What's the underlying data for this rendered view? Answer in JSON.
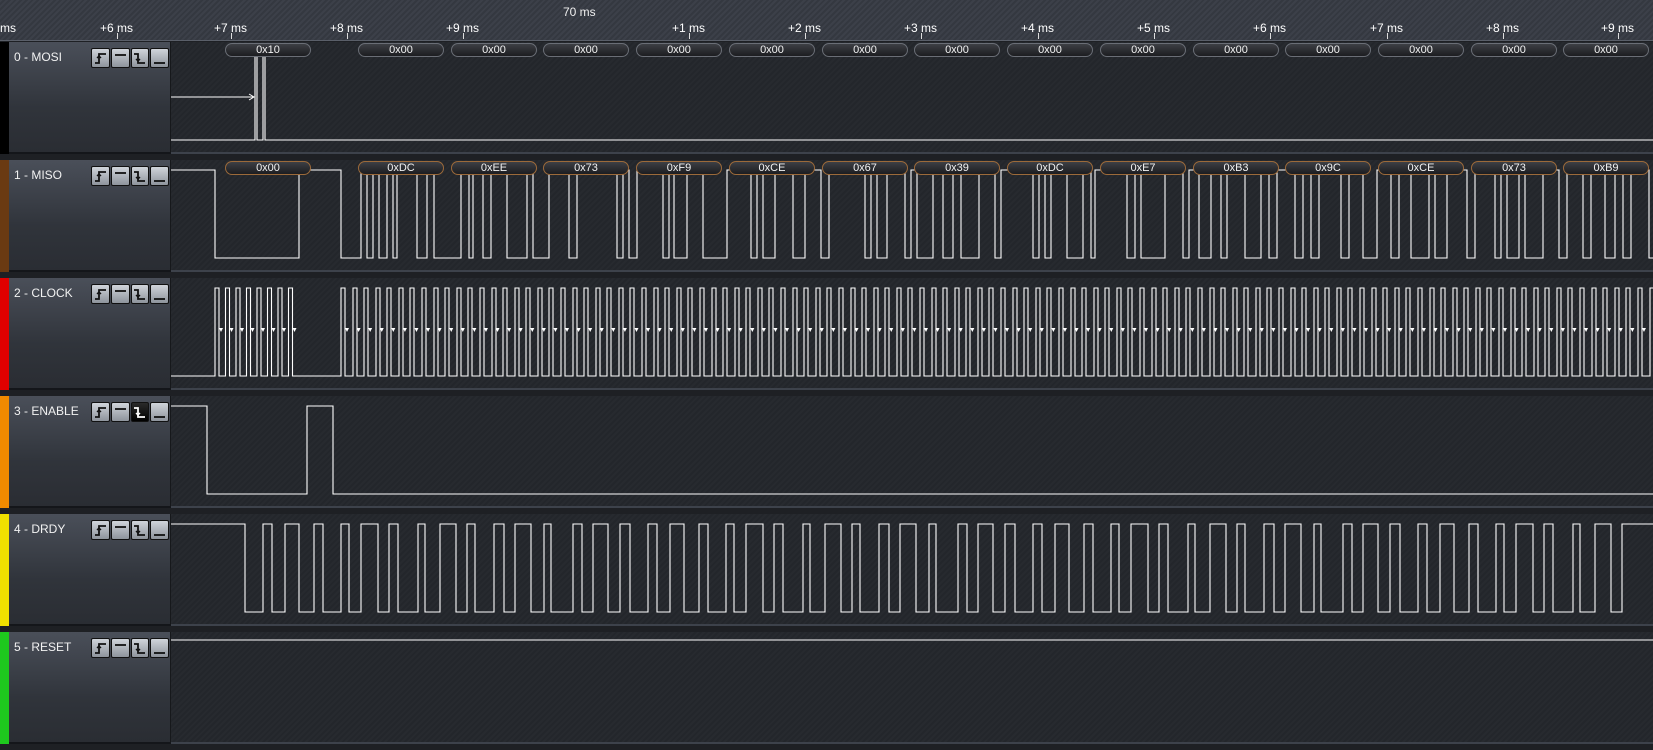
{
  "ruler": {
    "marker_label": "70 ms",
    "ticks": [
      {
        "label": "ms"
      },
      {
        "label": "+6 ms"
      },
      {
        "label": "+7 ms"
      },
      {
        "label": "+8 ms"
      },
      {
        "label": "+9 ms"
      },
      {
        "label": "+1 ms"
      },
      {
        "label": "+2 ms"
      },
      {
        "label": "+3 ms"
      },
      {
        "label": "+4 ms"
      },
      {
        "label": "+5 ms"
      },
      {
        "label": "+6 ms"
      },
      {
        "label": "+7 ms"
      },
      {
        "label": "+8 ms"
      },
      {
        "label": "+9 ms"
      }
    ]
  },
  "trigger_icons": [
    "rising-edge-icon",
    "high-level-icon",
    "falling-edge-icon",
    "low-level-icon"
  ],
  "channels": [
    {
      "name": "0 - MOSI",
      "color": "#000000",
      "active_trigger": -1
    },
    {
      "name": "1 - MISO",
      "color": "#6a3a12",
      "active_trigger": -1
    },
    {
      "name": "2 - CLOCK",
      "color": "#e00000",
      "active_trigger": -1
    },
    {
      "name": "3 - ENABLE",
      "color": "#f08a00",
      "active_trigger": 2
    },
    {
      "name": "4 - DRDY",
      "color": "#f0e000",
      "active_trigger": -1
    },
    {
      "name": "5 - RESET",
      "color": "#1ec81e",
      "active_trigger": -1
    }
  ],
  "mosi_bytes": [
    "0x10",
    "0x00",
    "0x00",
    "0x00",
    "0x00",
    "0x00",
    "0x00",
    "0x00",
    "0x00",
    "0x00",
    "0x00",
    "0x00",
    "0x00",
    "0x00",
    "0x00"
  ],
  "miso_bytes": [
    "0x00",
    "0xDC",
    "0xEE",
    "0x73",
    "0xF9",
    "0xCE",
    "0x67",
    "0x39",
    "0xDC",
    "0xE7",
    "0xB3",
    "0x9C",
    "0xCE",
    "0x73",
    "0xB9"
  ],
  "colors": {
    "waveform": "#ffffff",
    "panel": "#23262b",
    "ruler": "#383c44"
  }
}
